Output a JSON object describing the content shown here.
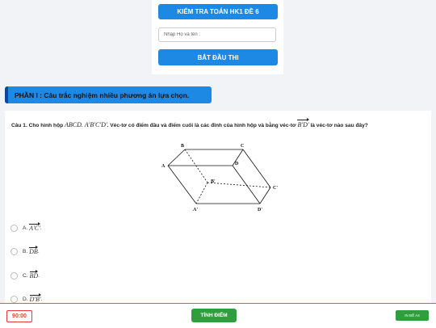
{
  "header": {
    "title": "KIỂM TRA TOÁN HK1 ĐỀ 6",
    "name_placeholder": "Nhập Họ và tên :",
    "start_label": "BẮT ĐẦU THI"
  },
  "section": {
    "title": "PHẦN I : Câu trắc nghiệm nhiều phương án lựa chọn."
  },
  "question": {
    "number_label": "Câu 1.",
    "text_1": "Cho hình hộp",
    "math_1": "ABCD. A′B′C′D′",
    "text_2": ". Véc-tơ có điểm đầu và điểm cuối là các đỉnh của hình hộp và bằng véc-tơ",
    "math_2": "B′D′",
    "text_3": "là véc-tơ nào sau đây?",
    "figure_labels": {
      "A": "A",
      "B": "B",
      "C": "C",
      "D": "D",
      "A1": "A'",
      "B1": "B'",
      "C1": "C'",
      "D1": "D'"
    },
    "options": [
      {
        "label": "A.",
        "vector": "A′C′",
        "suffix": "."
      },
      {
        "label": "B.",
        "vector": "DB",
        "suffix": "."
      },
      {
        "label": "C.",
        "vector": "BD",
        "suffix": "."
      },
      {
        "label": "D.",
        "vector": "D′B′",
        "suffix": "."
      }
    ]
  },
  "footer": {
    "timer": "90:00",
    "score_label": "TÍNH ĐIỂM",
    "print_label": "IN ĐỀ A4"
  },
  "colors": {
    "primary": "#1e88e5",
    "success": "#2e9e3e",
    "danger": "#e53935"
  }
}
